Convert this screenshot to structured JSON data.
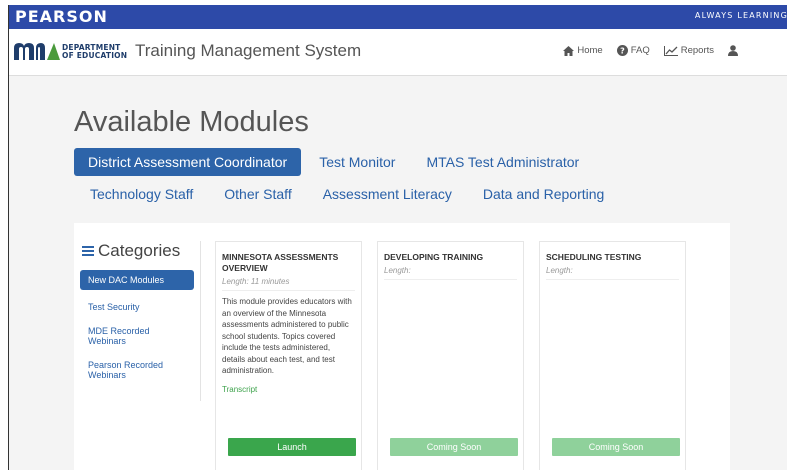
{
  "brand": {
    "pearson": "PEARSON",
    "tagline": "ALWAYS LEARNING",
    "department_line1": "DEPARTMENT",
    "department_line2": "OF EDUCATION",
    "app_title": "Training Management System",
    "logo_color": "#1f3d6b"
  },
  "nav": {
    "home": "Home",
    "faq": "FAQ",
    "reports": "Reports",
    "icons": [
      "home-icon",
      "question-circle-icon",
      "line-chart-icon",
      "user-icon"
    ]
  },
  "main": {
    "title": "Available Modules",
    "tabs_row1": [
      "District Assessment Coordinator",
      "Test Monitor",
      "MTAS Test Administrator"
    ],
    "tabs_row2": [
      "Technology Staff",
      "Other Staff",
      "Assessment Literacy",
      "Data and Reporting"
    ],
    "active_tab": "District Assessment Coordinator"
  },
  "categories": {
    "title": "Categories",
    "items": [
      "New DAC Modules",
      "Test Security",
      "MDE Recorded Webinars",
      "Pearson Recorded Webinars"
    ],
    "active": "New DAC Modules"
  },
  "cards": [
    {
      "title": "MINNESOTA ASSESSMENTS OVERVIEW",
      "length": "Length: 11 minutes",
      "description": "This module provides educators with an overview of the Minnesota assessments administered to public school students. Topics covered include the tests administered, details about each test, and test administration.",
      "transcript": "Transcript",
      "button": "Launch"
    },
    {
      "title": "DEVELOPING TRAINING",
      "length": "Length:",
      "button": "Coming Soon"
    },
    {
      "title": "SCHEDULING TESTING",
      "length": "Length:",
      "button": "Coming Soon"
    }
  ],
  "colors": {
    "pearson_blue": "#2d4aa8",
    "active_tab": "#2d64a9",
    "launch_green": "#3aa64c",
    "coming_soon_green": "#8fd19b"
  }
}
